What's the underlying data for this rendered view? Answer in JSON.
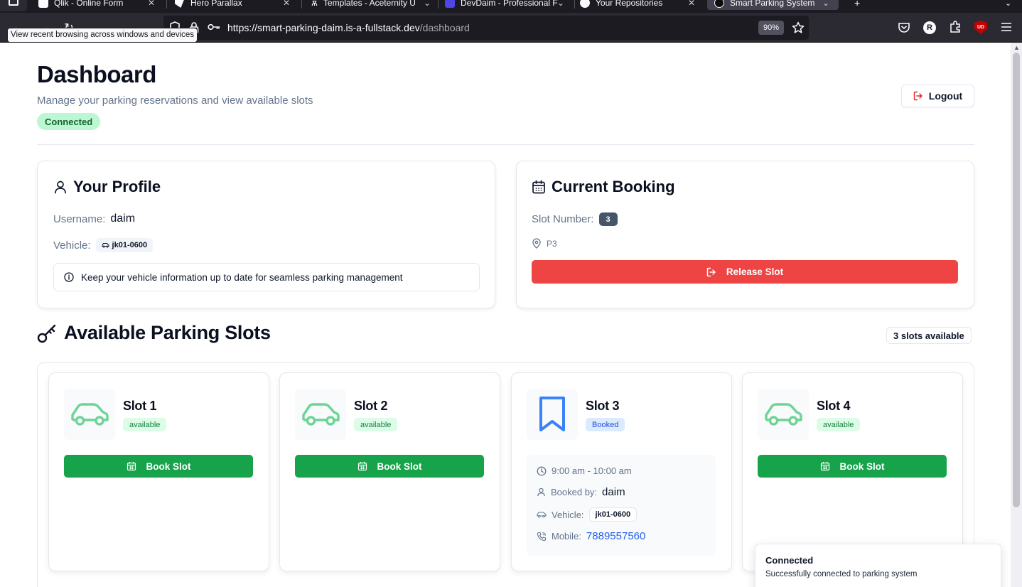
{
  "browser": {
    "tabs": [
      {
        "label": "Qlik - Online Form",
        "favicon_color": "#ffffff"
      },
      {
        "label": "Hero Parallax",
        "favicon_color": "#fbfbfe"
      },
      {
        "label": "Templates - Aceternity U",
        "favicon_color": "#fbfbfe"
      },
      {
        "label": "DevDaim - Professional F",
        "favicon_color": "#4f46e5"
      },
      {
        "label": "Your Repositories",
        "favicon_color": "#fbfbfe"
      },
      {
        "label": "Smart Parking System",
        "favicon_color": "#0c0c0d"
      }
    ],
    "url_host": "https://smart-parking-daim.is-a-fullstack.dev",
    "url_path": "/dashboard",
    "zoom": "90%",
    "tooltip": "View recent browsing across windows and devices",
    "profile_initial": "R",
    "ublock_label": "UD"
  },
  "header": {
    "title": "Dashboard",
    "subtitle": "Manage your parking reservations and view available slots",
    "connection_status": "Connected",
    "logout_label": "Logout"
  },
  "profile": {
    "title": "Your Profile",
    "username_label": "Username:",
    "username": "daim",
    "vehicle_label": "Vehicle:",
    "vehicle": "jk01-0600",
    "info_text": "Keep your vehicle information up to date for seamless parking management"
  },
  "booking": {
    "title": "Current Booking",
    "slot_number_label": "Slot Number:",
    "slot_number": "3",
    "location": "P3",
    "release_label": "Release Slot",
    "release_color": "#ef4444"
  },
  "slots_section": {
    "title": "Available Parking Slots",
    "count_text": "3 slots available",
    "available_color": "#16a34a",
    "booked_color": "#3b82f6",
    "slots": [
      {
        "name": "Slot 1",
        "status": "available",
        "action_label": "Book Slot"
      },
      {
        "name": "Slot 2",
        "status": "available",
        "action_label": "Book Slot"
      },
      {
        "name": "Slot 3",
        "status": "Booked",
        "time": "9:00 am - 10:00 am",
        "booked_by_label": "Booked by:",
        "booked_by": "daim",
        "vehicle_label": "Vehicle:",
        "vehicle": "jk01-0600",
        "mobile_label": "Mobile:",
        "mobile": "7889557560"
      },
      {
        "name": "Slot 4",
        "status": "available",
        "action_label": "Book Slot"
      }
    ]
  },
  "toast": {
    "title": "Connected",
    "description": "Successfully connected to parking system"
  }
}
